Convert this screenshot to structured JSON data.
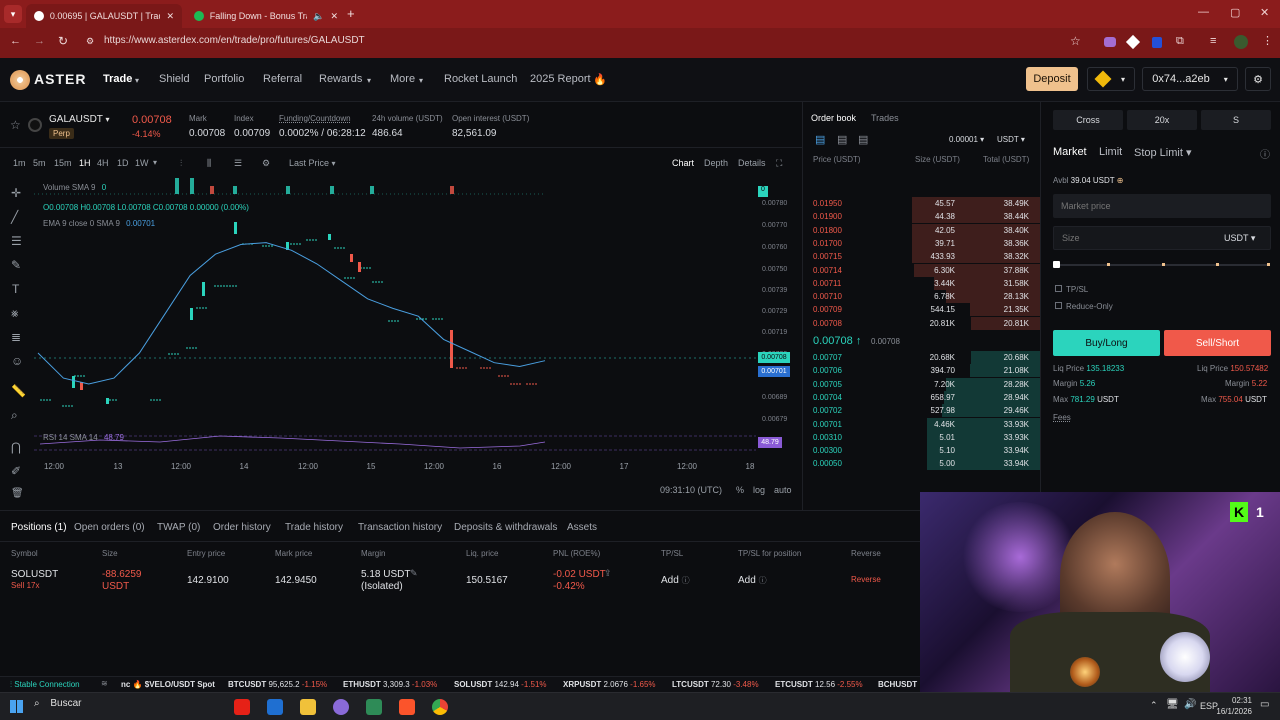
{
  "browser": {
    "tabs": [
      {
        "title": "0.00695 | GALAUSDT | Trade | A..."
      },
      {
        "title": "Falling Down - Bonus Track"
      }
    ],
    "url": "https://www.asterdex.com/en/trade/pro/futures/GALAUSDT"
  },
  "nav": {
    "brand": "ASTER",
    "items": [
      "Trade",
      "Shield",
      "Portfolio",
      "Referral",
      "Rewards",
      "More",
      "Rocket Launch",
      "2025 Report"
    ],
    "deposit": "Deposit",
    "account": "0x74...a2eb"
  },
  "ticker": {
    "symbol": "GALAUSDT",
    "type": "Perp",
    "last_price": "0.00708",
    "change": "-4.14%",
    "stats": [
      {
        "label": "Mark",
        "value": "0.00708"
      },
      {
        "label": "Index",
        "value": "0.00709"
      },
      {
        "label": "Funding/Countdown",
        "value": "0.0002% / 06:28:12"
      },
      {
        "label": "24h volume (USDT)",
        "value": "486.64"
      },
      {
        "label": "Open interest (USDT)",
        "value": "82,561.09"
      }
    ]
  },
  "chart_toolbar": {
    "intervals": [
      "1m",
      "5m",
      "15m",
      "1H",
      "4H",
      "1D",
      "1W"
    ],
    "price_type": "Last Price",
    "views": [
      "Chart",
      "Depth",
      "Details"
    ]
  },
  "chart_data": {
    "type": "line",
    "title": "",
    "legend_volume": "Volume SMA 9",
    "legend_volume_value": "0",
    "legend_ohlc": "O0.00708 H0.00708 L0.00708 C0.00708 0.00000 (0.00%)",
    "legend_ema": "EMA 9 close 0 SMA 9",
    "legend_ema_value": "0.00701",
    "legend_rsi": "RSI 14 SMA 14",
    "legend_rsi_value": "48.79",
    "x_ticks": [
      "12:00",
      "13",
      "12:00",
      "14",
      "12:00",
      "15",
      "12:00",
      "16",
      "12:00",
      "17",
      "12:00",
      "18"
    ],
    "y_ticks": [
      "0.00780",
      "0.00770",
      "0.00760",
      "0.00750",
      "0.00739",
      "0.00729",
      "0.00719",
      "0.00709",
      "0.00699",
      "0.00689",
      "0.00679"
    ],
    "ylim": [
      0.00674,
      0.00784
    ],
    "ema_series": {
      "name": "EMA 9",
      "x": [
        0,
        4,
        8,
        12,
        16,
        20,
        24,
        28,
        32,
        36,
        40,
        44,
        48,
        52,
        56,
        60,
        64,
        68,
        72,
        76,
        80
      ],
      "y": [
        0.00705,
        0.00692,
        0.00689,
        0.00692,
        0.00705,
        0.00725,
        0.00745,
        0.00756,
        0.00761,
        0.00762,
        0.00758,
        0.00751,
        0.00742,
        0.00733,
        0.00728,
        0.00724,
        0.00712,
        0.00706,
        0.007,
        0.00698,
        0.00701
      ]
    },
    "price_label": "0.00708",
    "ema_label": "0.00701",
    "rsi_label": "48.79",
    "volume_label": "0",
    "time": "09:31:10 (UTC)",
    "options": [
      "%",
      "log",
      "auto"
    ]
  },
  "orderbook": {
    "tabs": [
      "Order book",
      "Trades"
    ],
    "tick": "0.00001",
    "unit": "USDT",
    "headers": [
      "Price (USDT)",
      "Size (USDT)",
      "Total (USDT)"
    ],
    "asks": [
      {
        "price": "0.01950",
        "size": "45.57",
        "total": "38.49K",
        "depth": 0.99
      },
      {
        "price": "0.01900",
        "size": "44.38",
        "total": "38.44K",
        "depth": 0.99
      },
      {
        "price": "0.01800",
        "size": "42.05",
        "total": "38.40K",
        "depth": 0.99
      },
      {
        "price": "0.01700",
        "size": "39.71",
        "total": "38.36K",
        "depth": 0.99
      },
      {
        "price": "0.00715",
        "size": "433.93",
        "total": "38.32K",
        "depth": 0.99
      },
      {
        "price": "0.00714",
        "size": "6.30K",
        "total": "37.88K",
        "depth": 0.98
      },
      {
        "price": "0.00711",
        "size": "3.44K",
        "total": "31.58K",
        "depth": 0.82
      },
      {
        "price": "0.00710",
        "size": "6.78K",
        "total": "28.13K",
        "depth": 0.73
      },
      {
        "price": "0.00709",
        "size": "544.15",
        "total": "21.35K",
        "depth": 0.55
      },
      {
        "price": "0.00708",
        "size": "20.81K",
        "total": "20.81K",
        "depth": 0.54
      }
    ],
    "mid_price": "0.00708",
    "mid_mark": "0.00708",
    "bids": [
      {
        "price": "0.00707",
        "size": "20.68K",
        "total": "20.68K",
        "depth": 0.54
      },
      {
        "price": "0.00706",
        "size": "394.70",
        "total": "21.08K",
        "depth": 0.55
      },
      {
        "price": "0.00705",
        "size": "7.20K",
        "total": "28.28K",
        "depth": 0.73
      },
      {
        "price": "0.00704",
        "size": "658.97",
        "total": "28.94K",
        "depth": 0.75
      },
      {
        "price": "0.00702",
        "size": "527.98",
        "total": "29.46K",
        "depth": 0.76
      },
      {
        "price": "0.00701",
        "size": "4.46K",
        "total": "33.93K",
        "depth": 0.88
      },
      {
        "price": "0.00310",
        "size": "5.01",
        "total": "33.93K",
        "depth": 0.88
      },
      {
        "price": "0.00300",
        "size": "5.10",
        "total": "33.94K",
        "depth": 0.88
      },
      {
        "price": "0.00050",
        "size": "5.00",
        "total": "33.94K",
        "depth": 0.88
      }
    ]
  },
  "trade_panel": {
    "margin_mode": "Cross",
    "leverage": "20x",
    "mode_s": "S",
    "order_types": [
      "Market",
      "Limit",
      "Stop Limit"
    ],
    "avbl_label": "Avbl",
    "avbl": "39.04 USDT",
    "market_price_placeholder": "Market price",
    "size_placeholder": "Size",
    "size_unit": "USDT",
    "tpsl": "TP/SL",
    "reduce_only": "Reduce-Only",
    "buy": "Buy/Long",
    "sell": "Sell/Short",
    "liq_label": "Liq Price",
    "buy_liq": "135.18233",
    "sell_liq": "150.57482",
    "margin_label": "Margin",
    "buy_margin": "5.26",
    "sell_margin": "5.22",
    "max_label": "Max",
    "buy_max": "781.29",
    "sell_max": "755.04",
    "max_unit": "USDT",
    "fees": "Fees"
  },
  "positions": {
    "tabs": [
      "Positions (1)",
      "Open orders (0)",
      "TWAP (0)",
      "Order history",
      "Trade history",
      "Transaction history",
      "Deposits & withdrawals",
      "Assets"
    ],
    "headers": [
      "Symbol",
      "Size",
      "Entry price",
      "Mark price",
      "Margin",
      "Liq. price",
      "PNL (ROE%)",
      "TP/SL",
      "TP/SL for position",
      "Reverse"
    ],
    "row": {
      "symbol": "SOLUSDT",
      "side": "Sell 17x",
      "size": "-88.6259",
      "size_unit": "USDT",
      "entry": "142.9100",
      "mark": "142.9450",
      "margin": "5.18 USDT",
      "margin_type": "(Isolated)",
      "liq": "150.5167",
      "pnl": "-0.02 USDT",
      "roe": "-0.42%",
      "tpsl": "Add",
      "tpsl_pos": "Add",
      "reverse": "Reverse"
    }
  },
  "status_bar": {
    "connection": "Stable Connection",
    "tickers": [
      {
        "label": "nc 🔥 $VELO/USDT Spot",
        "price": "",
        "change": ""
      },
      {
        "label": "BTCUSDT",
        "price": "95,625.2",
        "change": "-1.15%"
      },
      {
        "label": "ETHUSDT",
        "price": "3,309.3",
        "change": "-1.03%"
      },
      {
        "label": "SOLUSDT",
        "price": "142.94",
        "change": "-1.51%"
      },
      {
        "label": "XRPUSDT",
        "price": "2.0676",
        "change": "-1.65%"
      },
      {
        "label": "LTCUSDT",
        "price": "72.30",
        "change": "-3.48%"
      },
      {
        "label": "ETCUSDT",
        "price": "12.56",
        "change": "-2.55%"
      },
      {
        "label": "BCHUSDT",
        "price": "",
        "change": ""
      }
    ]
  },
  "taskbar": {
    "search": "Buscar",
    "lang": "ESP",
    "time": "02:31",
    "date": "16/1/2026"
  },
  "colors": {
    "up": "#2bd4bd",
    "down": "#f0594a",
    "accent": "#efc18d",
    "browser": "#8b1c1c"
  }
}
